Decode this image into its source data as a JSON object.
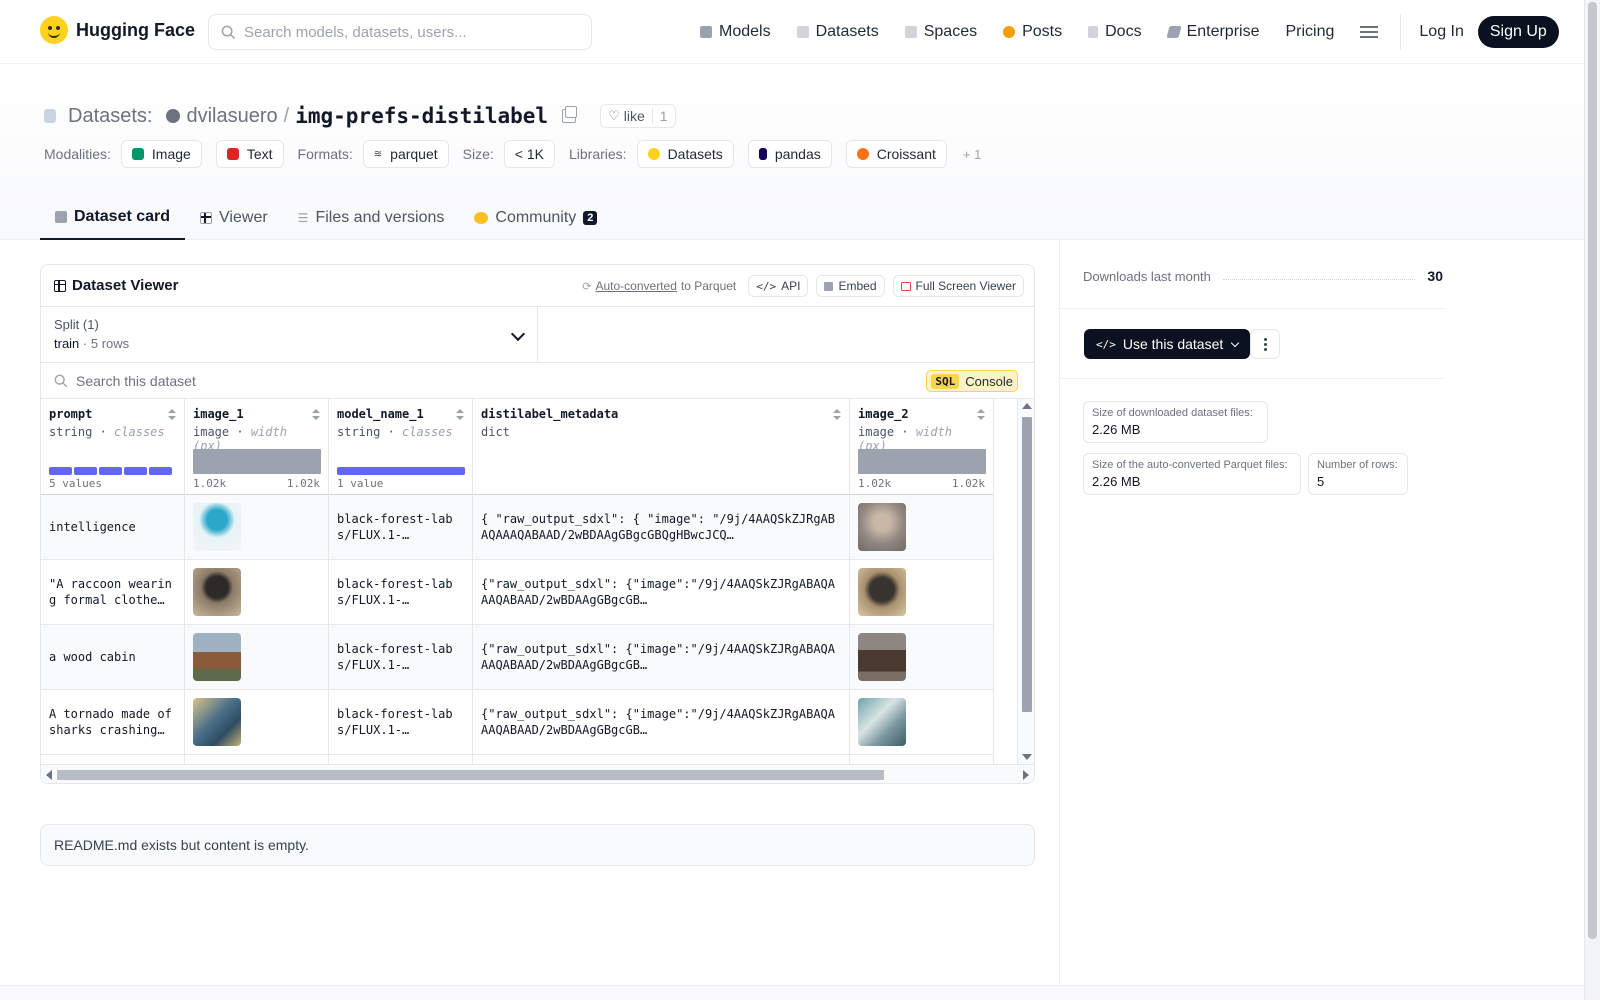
{
  "nav": {
    "brand": "Hugging Face",
    "search_placeholder": "Search models, datasets, users...",
    "items": [
      {
        "label": "Models",
        "icon": "cube-icon",
        "color": "#6b7280"
      },
      {
        "label": "Datasets",
        "icon": "database-icon",
        "color": "#9ca3af"
      },
      {
        "label": "Spaces",
        "icon": "grid-icon",
        "color": "#9ca3af"
      },
      {
        "label": "Posts",
        "icon": "speech-bubble-icon",
        "color": "#f59e0b"
      },
      {
        "label": "Docs",
        "icon": "document-icon",
        "color": "#9ca3af"
      },
      {
        "label": "Enterprise",
        "icon": "enterprise-icon",
        "color": "#6b7280"
      },
      {
        "label": "Pricing",
        "icon": "",
        "color": ""
      }
    ],
    "login": "Log In",
    "signup": "Sign Up"
  },
  "header": {
    "section": "Datasets:",
    "owner": "dvilasuero",
    "separator": "/",
    "name": "img-prefs-distilabel",
    "like_label": "like",
    "like_count": "1",
    "modalities_label": "Modalities:",
    "modalities": [
      {
        "label": "Image",
        "icon": "image-icon",
        "color": "#059669"
      },
      {
        "label": "Text",
        "icon": "text-icon",
        "color": "#dc2626"
      }
    ],
    "formats_label": "Formats:",
    "format": "parquet",
    "size_label": "Size:",
    "size": "< 1K",
    "libraries_label": "Libraries:",
    "libraries": [
      {
        "label": "Datasets",
        "icon": "hf-icon",
        "color": "#ffd21e"
      },
      {
        "label": "pandas",
        "icon": "pandas-icon",
        "color": "#150458"
      },
      {
        "label": "Croissant",
        "icon": "croissant-icon",
        "color": "#f97316"
      }
    ],
    "more": "+ 1"
  },
  "tabs": [
    {
      "label": "Dataset card",
      "active": true
    },
    {
      "label": "Viewer",
      "active": false
    },
    {
      "label": "Files and versions",
      "active": false
    },
    {
      "label": "Community",
      "active": false,
      "badge": "2"
    }
  ],
  "viewer": {
    "title": "Dataset Viewer",
    "auto_converted": "Auto-converted",
    "to_parquet": "to Parquet",
    "api": "API",
    "embed": "Embed",
    "full_screen": "Full Screen Viewer",
    "split_label": "Split (1)",
    "split_name": "train",
    "split_dot": "·",
    "split_rows": "5 rows",
    "search_placeholder": "Search this dataset",
    "sql_tag": "SQL",
    "sql_label": "Console",
    "columns": [
      {
        "name": "prompt",
        "type": "string",
        "sub": "classes",
        "stat": "5 values",
        "stat_r": ""
      },
      {
        "name": "image_1",
        "type": "image",
        "sub": "width (px)",
        "stat": "1.02k",
        "stat_r": "1.02k"
      },
      {
        "name": "model_name_1",
        "type": "string",
        "sub": "classes",
        "stat": "1 value",
        "stat_r": ""
      },
      {
        "name": "distilabel_metadata",
        "type": "dict",
        "sub": "",
        "stat": "",
        "stat_r": ""
      },
      {
        "name": "image_2",
        "type": "image",
        "sub": "width (px)",
        "stat": "1.02k",
        "stat_r": "1.02k"
      }
    ],
    "rows": [
      {
        "prompt": "intelligence",
        "model": "black-forest-labs/FLUX.1-…",
        "meta": "{ \"raw_output_sdxl\": { \"image\": \"/9j/4AAQSkZJRgABAQAAAQABAAD/2wBDAAgGBgcGBQgHBwcJCQ…",
        "img1": "#cfe7f1",
        "img2": "#a8a29e"
      },
      {
        "prompt": "\"A raccoon wearing formal clothes,…",
        "model": "black-forest-labs/FLUX.1-…",
        "meta": "{\"raw_output_sdxl\": {\"image\":\"/9j/4AAQSkZJRgABAQAAAQABAAD/2wBDAAgGBgcGB…",
        "img1": "#7c6a5a",
        "img2": "#b8a58a"
      },
      {
        "prompt": "a wood cabin",
        "model": "black-forest-labs/FLUX.1-…",
        "meta": "{\"raw_output_sdxl\": {\"image\":\"/9j/4AAQSkZJRgABAQAAAQABAAD/2wBDAAgGBgcGB…",
        "img1": "#7b8b99",
        "img2": "#6b5d55"
      },
      {
        "prompt": "A tornado made of sharks crashing…",
        "model": "black-forest-labs/FLUX.1-…",
        "meta": "{\"raw_output_sdxl\": {\"image\":\"/9j/4AAQSkZJRgABAQAAAQABAAD/2wBDAAgGBgcGB…",
        "img1": "#5b7f9a",
        "img2": "#8fb0b8"
      }
    ]
  },
  "readme": "README.md exists but content is empty.",
  "sidebar": {
    "downloads_label": "Downloads last month",
    "downloads_value": "30",
    "use_button": "Use this dataset",
    "stats": [
      {
        "label": "Size of downloaded dataset files:",
        "value": "2.26 MB"
      },
      {
        "label": "Size of the auto-converted Parquet files:",
        "value": "2.26 MB"
      },
      {
        "label": "Number of rows:",
        "value": "5"
      }
    ]
  }
}
